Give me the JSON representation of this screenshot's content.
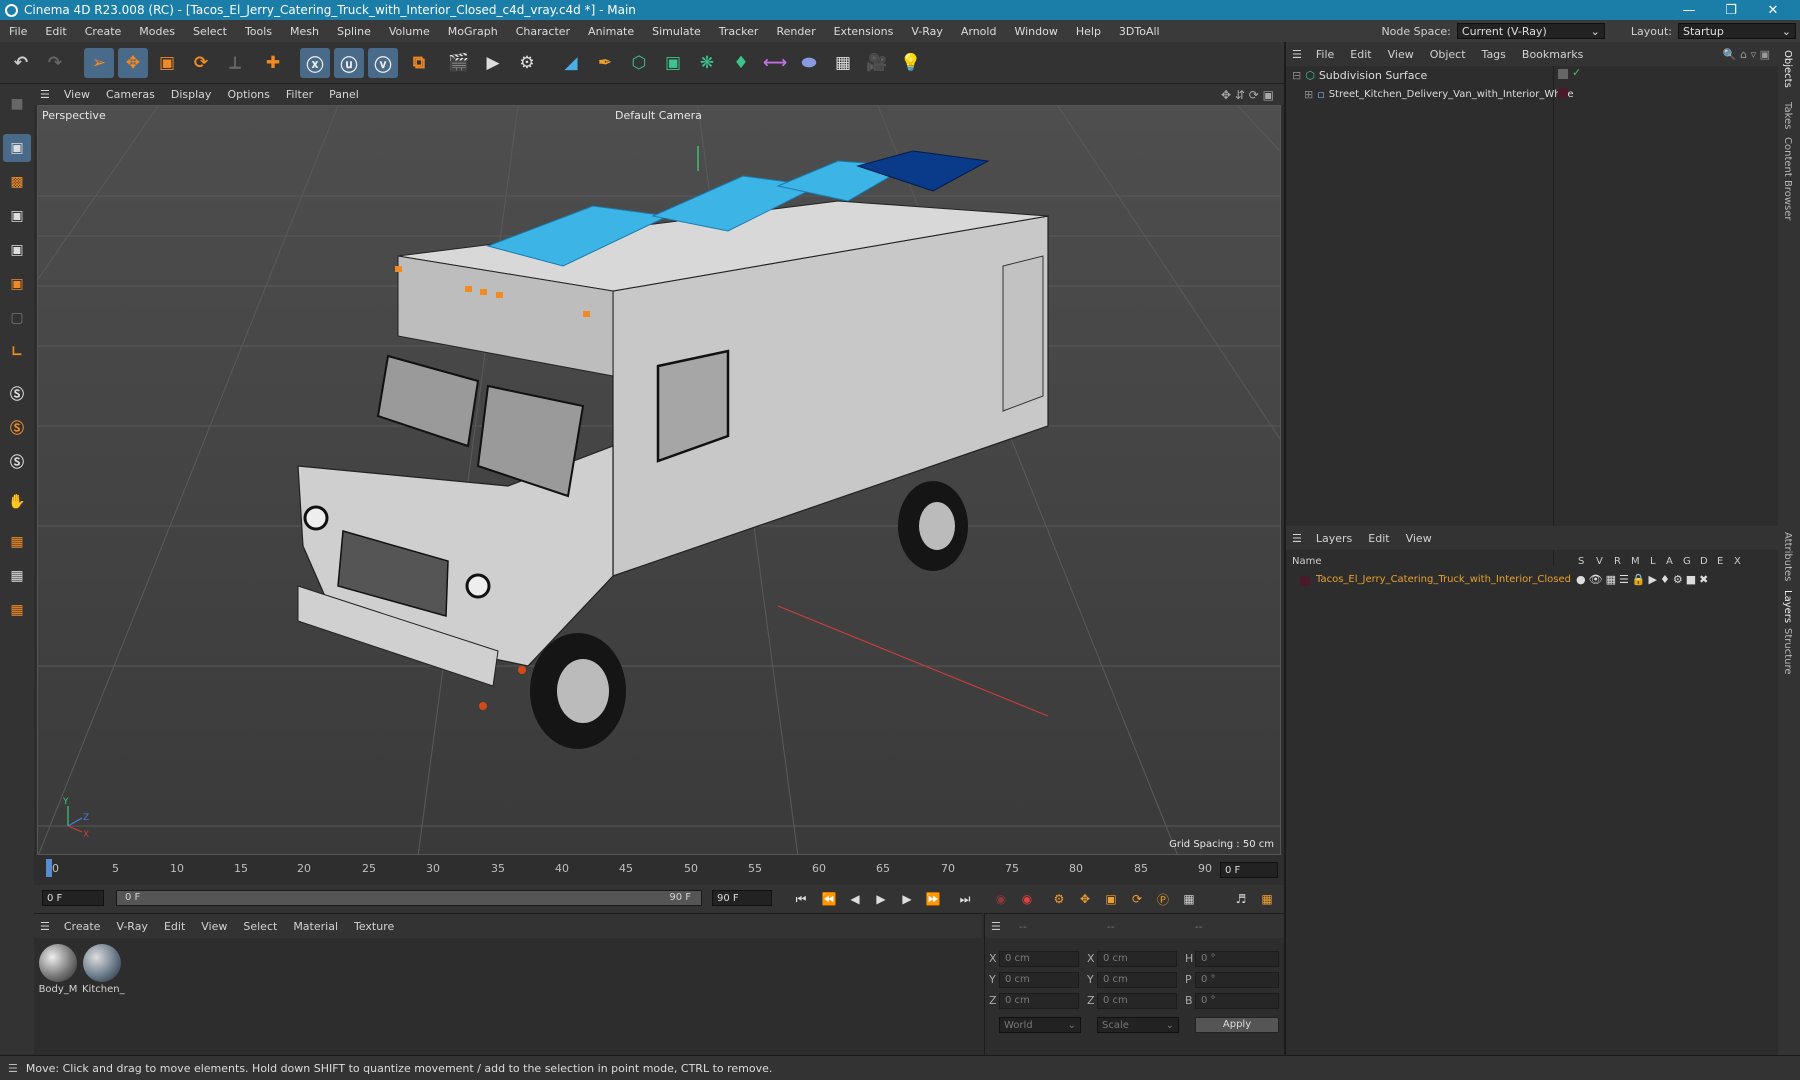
{
  "window": {
    "title": "Cinema 4D R23.008 (RC) - [Tacos_El_Jerry_Catering_Truck_with_Interior_Closed_c4d_vray.c4d *] - Main"
  },
  "menu": [
    "File",
    "Edit",
    "Create",
    "Modes",
    "Select",
    "Tools",
    "Mesh",
    "Spline",
    "Volume",
    "MoGraph",
    "Character",
    "Animate",
    "Simulate",
    "Tracker",
    "Render",
    "Extensions",
    "V-Ray",
    "Arnold",
    "Window",
    "Help",
    "3DToAll"
  ],
  "node_space": {
    "label": "Node Space:",
    "value": "Current (V-Ray)"
  },
  "layout": {
    "label": "Layout:",
    "value": "Startup"
  },
  "viewport": {
    "menu": [
      "View",
      "Cameras",
      "Display",
      "Options",
      "Filter",
      "Panel"
    ],
    "name": "Perspective",
    "camera": "Default Camera",
    "grid_spacing": "Grid Spacing : 50 cm"
  },
  "timeline": {
    "ticks": [
      "0",
      "5",
      "10",
      "15",
      "20",
      "25",
      "30",
      "35",
      "40",
      "45",
      "50",
      "55",
      "60",
      "65",
      "70",
      "75",
      "80",
      "85",
      "90"
    ],
    "current_frame": "0 F",
    "start": "0 F",
    "range_start": "0 F",
    "range_end": "90 F",
    "end": "90 F"
  },
  "materials": {
    "menu": [
      "Create",
      "V-Ray",
      "Edit",
      "View",
      "Select",
      "Material",
      "Texture"
    ],
    "items": [
      "Body_M",
      "Kitchen_"
    ]
  },
  "coordinates": {
    "header": [
      "--",
      "--",
      "--"
    ],
    "rows": [
      {
        "a": "X",
        "av": "0 cm",
        "b": "X",
        "bv": "0 cm",
        "c": "H",
        "cv": "0 °"
      },
      {
        "a": "Y",
        "av": "0 cm",
        "b": "Y",
        "bv": "0 cm",
        "c": "P",
        "cv": "0 °"
      },
      {
        "a": "Z",
        "av": "0 cm",
        "b": "Z",
        "bv": "0 cm",
        "c": "B",
        "cv": "0 °"
      }
    ],
    "world": "World",
    "scale": "Scale",
    "apply": "Apply"
  },
  "objects": {
    "menu": [
      "File",
      "Edit",
      "View",
      "Object",
      "Tags",
      "Bookmarks"
    ],
    "items": [
      "Subdivision Surface",
      "Street_Kitchen_Delivery_Van_with_Interior_White"
    ]
  },
  "layers": {
    "menu": [
      "Layers",
      "Edit",
      "View"
    ],
    "name_col": "Name",
    "cols": [
      "S",
      "V",
      "R",
      "M",
      "L",
      "A",
      "G",
      "D",
      "E",
      "X"
    ],
    "item": "Tacos_El_Jerry_Catering_Truck_with_Interior_Closed"
  },
  "side_tabs": [
    "Objects",
    "Takes",
    "Content Browser",
    "Attributes",
    "Layers",
    "Structure"
  ],
  "status": "Move: Click and drag to move elements. Hold down SHIFT to quantize movement / add to the selection in point mode, CTRL to remove.",
  "colors": {
    "accent": "#1b7ea8",
    "highlight": "#f08a24",
    "layer": "#e8a030"
  }
}
